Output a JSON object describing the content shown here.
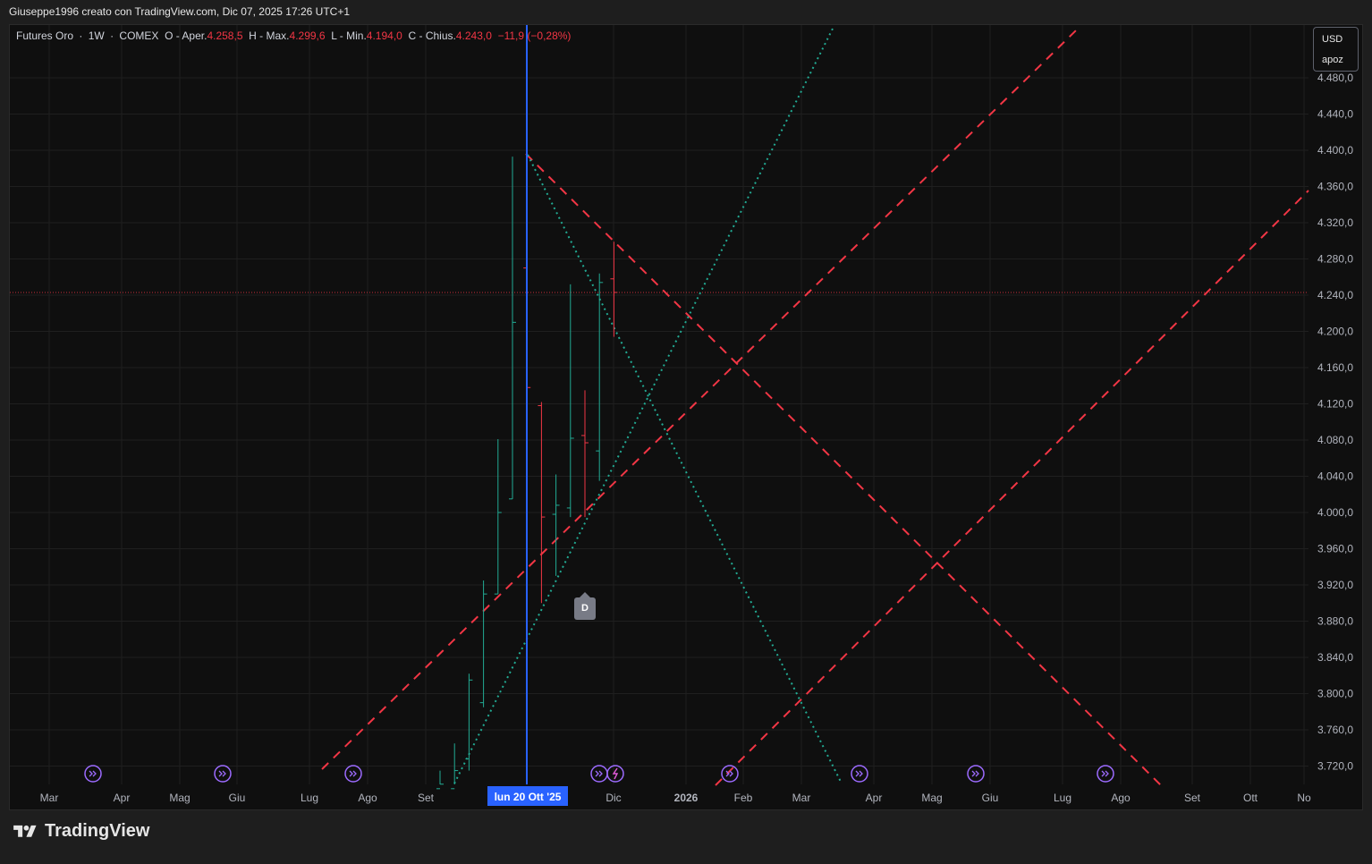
{
  "header": {
    "snapshot_caption": "Giuseppe1996 creato con TradingView.com, Dic 07, 2025 17:26 UTC+1"
  },
  "legend": {
    "symbol": "Futures Oro",
    "interval": "1W",
    "exchange": "COMEX",
    "open_label": "O - Aper.",
    "open_value": "4.258,5",
    "high_label": "H - Max.",
    "high_value": "4.299,6",
    "low_label": "L - Min.",
    "low_value": "4.194,0",
    "close_label": "C - Chius.",
    "close_value": "4.243,0",
    "change_value": "−11,9 (−0,28%)"
  },
  "price_scale": {
    "currency": "USD",
    "unit": "apoz"
  },
  "crosshair": {
    "date_label": "lun 20 Ott '25"
  },
  "marker": {
    "label": "D"
  },
  "brand": {
    "name": "TradingView"
  },
  "colors": {
    "background": "#0f0f0f",
    "grid": "#1f1f1f",
    "up": "#22ab94",
    "down": "#f23645",
    "crosshair": "#2962ff",
    "dashed_lines": "#f23645",
    "dotted_lines": "#22ab94",
    "event_icon": "#9c6bff"
  },
  "chart_data": {
    "type": "ohlc",
    "interval": "1W",
    "ylim": [
      3690,
      4505
    ],
    "y_ticks": [
      3720,
      3760,
      3800,
      3840,
      3880,
      3920,
      3960,
      4000,
      4040,
      4080,
      4120,
      4160,
      4200,
      4240,
      4280,
      4320,
      4360,
      4400,
      4440,
      4480
    ],
    "y_tick_labels": [
      "3.720,0",
      "3.760,0",
      "3.800,0",
      "3.840,0",
      "3.880,0",
      "3.920,0",
      "3.960,0",
      "4.000,0",
      "4.040,0",
      "4.080,0",
      "4.120,0",
      "4.160,0",
      "4.200,0",
      "4.240,0",
      "4.280,0",
      "4.320,0",
      "4.360,0",
      "4.400,0",
      "4.440,0",
      "4.480,0"
    ],
    "x_labels": [
      "Mar",
      "Apr",
      "Mag",
      "Giu",
      "Lug",
      "Ago",
      "Set",
      "Dic",
      "2026",
      "Feb",
      "Mar",
      "Apr",
      "Mag",
      "Giu",
      "Lug",
      "Ago",
      "Set",
      "Ott",
      "No"
    ],
    "current_price": 4243,
    "bars": [
      {
        "o": 3695,
        "h": 3715,
        "l": 3690,
        "c": 3700
      },
      {
        "o": 3695,
        "h": 3745,
        "l": 3690,
        "c": 3715
      },
      {
        "o": 3728,
        "h": 3822,
        "l": 3715,
        "c": 3815
      },
      {
        "o": 3790,
        "h": 3925,
        "l": 3785,
        "c": 3910
      },
      {
        "o": 3910,
        "h": 4081,
        "l": 3910,
        "c": 4000
      },
      {
        "o": 4015,
        "h": 4393,
        "l": 4015,
        "c": 4210
      },
      {
        "o": 4270,
        "h": 4396,
        "l": 3945,
        "c": 4138
      },
      {
        "o": 4118,
        "h": 4122,
        "l": 3900,
        "c": 3995
      },
      {
        "o": 3998,
        "h": 4042,
        "l": 3930,
        "c": 4008
      },
      {
        "o": 4005,
        "h": 4252,
        "l": 3995,
        "c": 4082
      },
      {
        "o": 4085,
        "h": 4135,
        "l": 3995,
        "c": 4077
      },
      {
        "o": 4068,
        "h": 4264,
        "l": 4035,
        "c": 4254
      },
      {
        "o": 4258,
        "h": 4299,
        "l": 4194,
        "c": 4243
      }
    ]
  }
}
